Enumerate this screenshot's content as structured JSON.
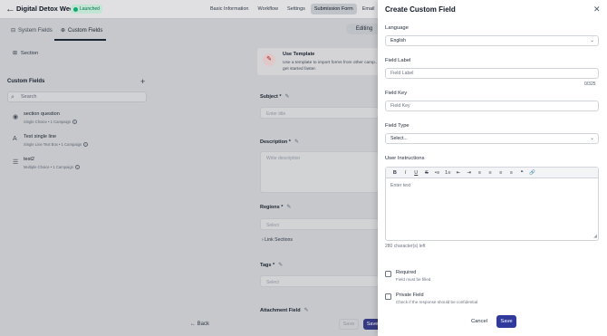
{
  "header": {
    "back_icon": "arrow-left-icon",
    "title": "Digital Detox Week",
    "status_badge": "Launched",
    "nav": [
      "Basic Information",
      "Workflow",
      "Settings",
      "Submission Form",
      "Email",
      "R"
    ],
    "nav_active": "Submission Form"
  },
  "subtabs": {
    "system_fields": "System Fields",
    "custom_fields": "Custom Fields",
    "editing": "Editing"
  },
  "left_panel": {
    "section_label": "Section",
    "custom_fields_title": "Custom Fields",
    "search_placeholder": "Search",
    "items": [
      {
        "name": "section question",
        "meta": "Single Choice • 1 Campaign"
      },
      {
        "name": "Test single line",
        "meta": "Single Line Text Box • 1 Campaign"
      },
      {
        "name": "test2",
        "meta": "Multiple Choice • 1 Campaign"
      }
    ]
  },
  "center": {
    "template_title": "Use Template",
    "template_desc": "Use a template to import forms from other camp... get started faster.",
    "subject_label": "Subject *",
    "subject_placeholder": "Enter title",
    "description_label": "Description *",
    "description_placeholder": "Write description",
    "regions_label": "Regions *",
    "regions_placeholder": "Select",
    "link_sections": "Link Sections",
    "tags_label": "Tags *",
    "tags_placeholder": "Select",
    "attachment_label": "Attachment Field"
  },
  "bottom": {
    "back": "Back",
    "save_disabled": "Save",
    "save2": "Save"
  },
  "drawer": {
    "title": "Create Custom Field",
    "language_label": "Language",
    "language_value": "English",
    "field_label_label": "Field Label",
    "field_label_placeholder": "Field Label",
    "char_count": "0/325",
    "field_key_label": "Field Key",
    "field_key_placeholder": "Field Key",
    "field_type_label": "Field Type",
    "field_type_placeholder": "Select...",
    "user_instructions_label": "User Instructions",
    "editor_placeholder": "Enter text",
    "characters_left": "280 character(s) left",
    "required_label": "Required",
    "required_desc": "Field must be filled",
    "private_label": "Private Field",
    "private_desc": "Check if the response should be confidential",
    "cancel": "Cancel",
    "save": "Save",
    "toolbar": [
      "B",
      "I",
      "U",
      "S",
      "•≡",
      "1≡",
      "⇤",
      "⇥",
      "≡",
      "≡",
      "≡",
      "≡",
      "❝",
      "🔗"
    ]
  }
}
